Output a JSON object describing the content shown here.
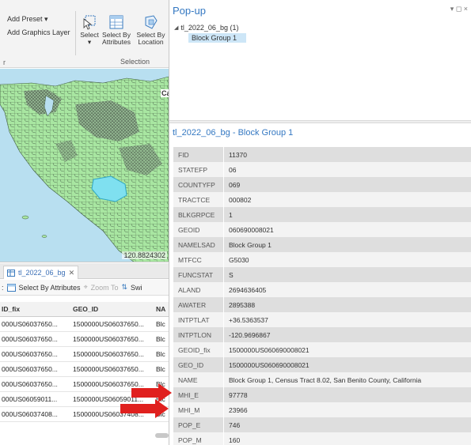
{
  "ribbon": {
    "add_preset": "Add Preset ▾",
    "add_graphics_layer": "Add Graphics Layer",
    "left_group_label": "r",
    "select": "Select",
    "select_dropdown": "▾",
    "select_by_attributes_l1": "Select By",
    "select_by_attributes_l2": "Attributes",
    "select_by_location_l1": "Select By",
    "select_by_location_l2": "Location",
    "selection_group_label": "Selection"
  },
  "map": {
    "coordinate_readout": "120.8824302",
    "place_label": "Ca"
  },
  "attribute_table": {
    "tab_label": "tl_2022_06_bg",
    "tab_close": "✕",
    "toolbar_prefix": ":",
    "select_by_attributes": "Select By Attributes",
    "zoom_to": "Zoom To",
    "switch": "Swi",
    "columns": [
      "ID_fix",
      "GEO_ID",
      "NA"
    ],
    "rows": [
      [
        "000US06037650...",
        "1500000US06037650...",
        "Blc"
      ],
      [
        "000US06037650...",
        "1500000US06037650...",
        "Blc"
      ],
      [
        "000US06037650...",
        "1500000US06037650...",
        "Blc"
      ],
      [
        "000US06037650...",
        "1500000US06037650...",
        "Blc"
      ],
      [
        "000US06037650...",
        "1500000US06037650...",
        "Blc"
      ],
      [
        "000US06059011...",
        "1500000US06059011...",
        "Blc"
      ],
      [
        "000US06037408...",
        "1500000US06037408...",
        "Blc"
      ]
    ]
  },
  "popup": {
    "title": "Pop-up",
    "controls": "▾ ◻ ×",
    "tree_layer": "tl_2022_06_bg  (1)",
    "tree_feature": "Block Group 1",
    "feature_title": "tl_2022_06_bg - Block Group 1",
    "fields": [
      {
        "name": "FID",
        "value": "11370"
      },
      {
        "name": "STATEFP",
        "value": "06"
      },
      {
        "name": "COUNTYFP",
        "value": "069"
      },
      {
        "name": "TRACTCE",
        "value": "000802"
      },
      {
        "name": "BLKGRPCE",
        "value": "1"
      },
      {
        "name": "GEOID",
        "value": "060690008021"
      },
      {
        "name": "NAMELSAD",
        "value": "Block Group 1"
      },
      {
        "name": "MTFCC",
        "value": "G5030"
      },
      {
        "name": "FUNCSTAT",
        "value": "S"
      },
      {
        "name": "ALAND",
        "value": "2694636405"
      },
      {
        "name": "AWATER",
        "value": "2895388"
      },
      {
        "name": "INTPTLAT",
        "value": "+36.5363537"
      },
      {
        "name": "INTPTLON",
        "value": "-120.9696867"
      },
      {
        "name": "GEOID_fix",
        "value": "1500000US060690008021"
      },
      {
        "name": "GEO_ID",
        "value": "1500000US060690008021"
      },
      {
        "name": "NAME",
        "value": "Block Group 1, Census Tract 8.02, San Benito County, California"
      },
      {
        "name": "MHI_E",
        "value": "97778"
      },
      {
        "name": "MHI_M",
        "value": "23966"
      },
      {
        "name": "POP_E",
        "value": "746"
      },
      {
        "name": "POP_M",
        "value": "160"
      }
    ]
  },
  "colors": {
    "accent_blue": "#3478c2",
    "land_green": "#a8e6a1",
    "water_blue": "#b8dff0",
    "selected_cyan": "#7fe0f0",
    "annotation_red": "#e0201e"
  }
}
